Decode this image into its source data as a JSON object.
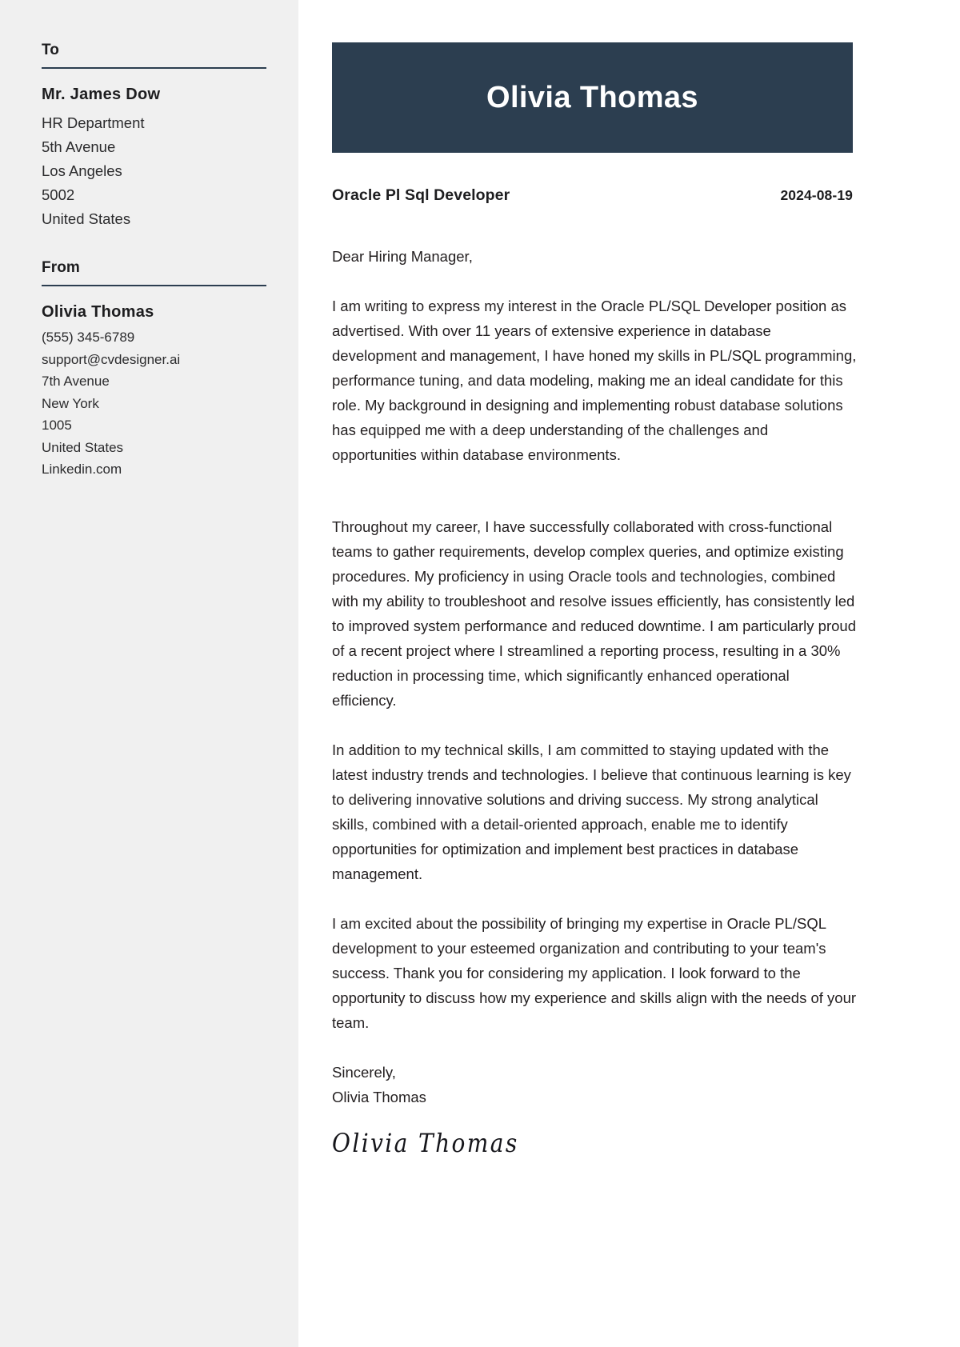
{
  "sidebar": {
    "to": {
      "heading": "To",
      "name": "Mr. James Dow",
      "lines": [
        "HR Department",
        "5th Avenue",
        "Los Angeles",
        "5002",
        "United States"
      ]
    },
    "from": {
      "heading": "From",
      "name": "Olivia Thomas",
      "lines": [
        "(555) 345-6789",
        "support@cvdesigner.ai",
        "7th Avenue",
        "New York",
        "1005",
        "United States",
        "Linkedin.com"
      ]
    }
  },
  "header": {
    "name": "Olivia Thomas",
    "banner_color": "#2c3e50"
  },
  "meta": {
    "job_title": "Oracle Pl Sql Developer",
    "date": "2024-08-19"
  },
  "letter": {
    "salutation": "Dear Hiring Manager,",
    "paragraphs": [
      "I am writing to express my interest in the Oracle PL/SQL Developer position as advertised. With over 11 years of extensive experience in database development and management, I have honed my skills in PL/SQL programming, performance tuning, and data modeling, making me an ideal candidate for this role. My background in designing and implementing robust database solutions has equipped me with a deep understanding of the challenges and opportunities within database environments.",
      "Throughout my career, I have successfully collaborated with cross-functional teams to gather requirements, develop complex queries, and optimize existing procedures. My proficiency in using Oracle tools and technologies, combined with my ability to troubleshoot and resolve issues efficiently, has consistently led to improved system performance and reduced downtime. I am particularly proud of a recent project where I streamlined a reporting process, resulting in a 30% reduction in processing time, which significantly enhanced operational efficiency.",
      "In addition to my technical skills, I am committed to staying updated with the latest industry trends and technologies. I believe that continuous learning is key to delivering innovative solutions and driving success. My strong analytical skills, combined with a detail-oriented approach, enable me to identify opportunities for optimization and implement best practices in database management.",
      "I am excited about the possibility of bringing my expertise in Oracle PL/SQL development to your esteemed organization and contributing to your team's success. Thank you for considering my application. I look forward to the opportunity to discuss how my experience and skills align with the needs of your team."
    ],
    "closing": "Sincerely,",
    "closing_name": "Olivia Thomas",
    "signature": "Olivia Thomas"
  }
}
